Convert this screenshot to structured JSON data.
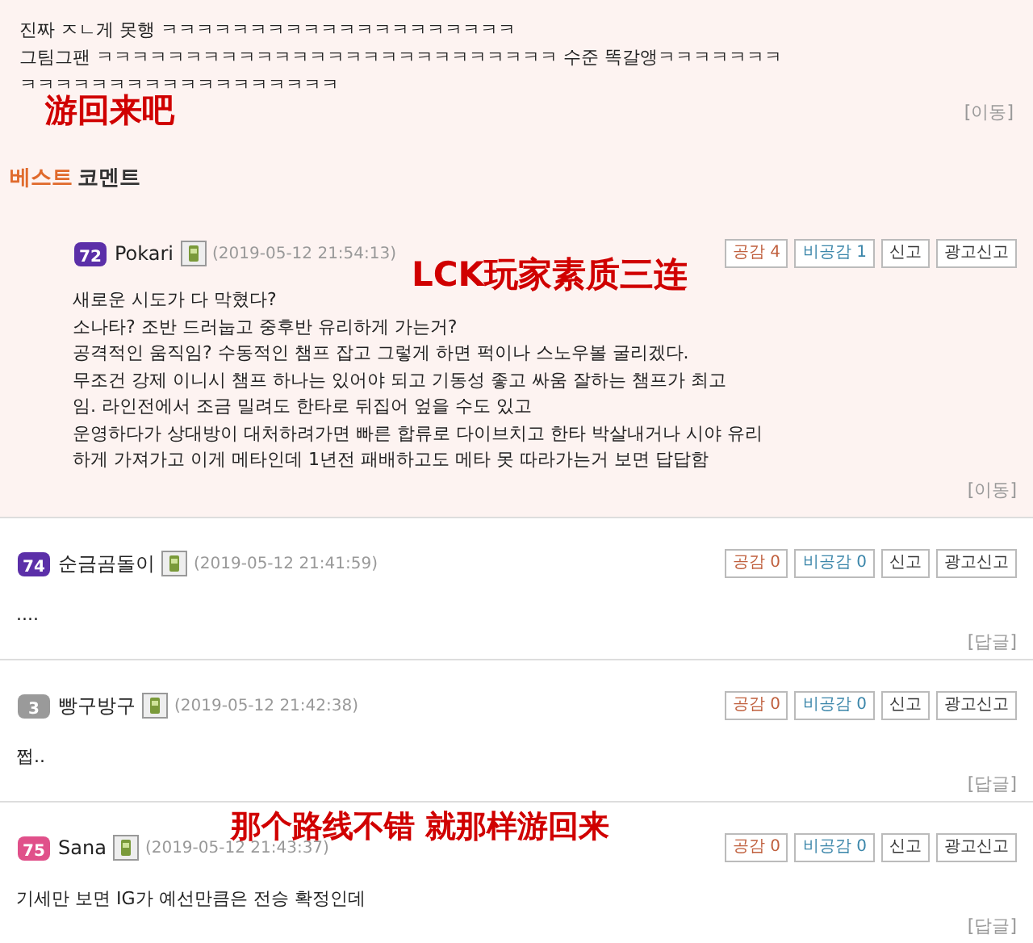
{
  "previous_comment": {
    "lines": [
      "진짜 ㅈㄴ게 못행 ㅋㅋㅋㅋㅋㅋㅋㅋㅋㅋㅋㅋㅋㅋㅋㅋㅋㅋㅋㅋ",
      "그팀그팬 ㅋㅋㅋㅋㅋㅋㅋㅋㅋㅋㅋㅋㅋㅋㅋㅋㅋㅋㅋㅋㅋㅋㅋㅋㅋㅋ 수준 똑갈앵ㅋㅋㅋㅋㅋㅋㅋ",
      "ㅋㅋㅋㅋㅋㅋㅋㅋㅋㅋㅋㅋㅋㅋㅋㅋㅋㅋ"
    ],
    "action": "[이동]"
  },
  "best_header": {
    "part_1": "베스트",
    "part_2": "코멘트"
  },
  "comments": [
    {
      "best": true,
      "level": "72",
      "color": "#5b2fa8",
      "user": "Pokari",
      "time": "(2019-05-12 21:54:13)",
      "likes": "공감 4",
      "dislikes": "비공감 1",
      "report": "신고",
      "ad_report": "광고신고",
      "lines": [
        "새로운 시도가 다 막혔다?",
        "소나타? 조반 드러눕고 중후반 유리하게 가는거?",
        "공격적인 움직임? 수동적인 챔프 잡고 그렇게 하면 퍽이나 스노우볼 굴리겠다.",
        "무조건 강제 이니시 챔프 하나는 있어야 되고 기동성 좋고 싸움 잘하는 챔프가 최고",
        "임. 라인전에서 조금 밀려도 한타로 뒤집어 엎을 수도 있고",
        "운영하다가 상대방이 대처하려가면 빠른 합류로 다이브치고 한타 박살내거나 시야 유리",
        "하게 가져가고 이게 메타인데 1년전 패배하고도 메타 못 따라가는거 보면 답답함"
      ],
      "action": "[이동]"
    },
    {
      "best": false,
      "level": "74",
      "color": "#5b2fa8",
      "user": "순금곰돌이",
      "time": "(2019-05-12 21:41:59)",
      "likes": "공감 0",
      "dislikes": "비공감 0",
      "report": "신고",
      "ad_report": "광고신고",
      "lines": [
        "...."
      ],
      "action": "[답글]"
    },
    {
      "best": false,
      "level": "3",
      "color": "#9a9a9a",
      "user": "빵구방구",
      "time": "(2019-05-12 21:42:38)",
      "likes": "공감 0",
      "dislikes": "비공감 0",
      "report": "신고",
      "ad_report": "광고신고",
      "lines": [
        "쩝.."
      ],
      "action": "[답글]"
    },
    {
      "best": false,
      "level": "75",
      "color": "#e0508a",
      "user": "Sana",
      "time": "(2019-05-12 21:43:37)",
      "likes": "공감 0",
      "dislikes": "비공감 0",
      "report": "신고",
      "ad_report": "광고신고",
      "lines": [
        "기세만 보면 IG가 예선만큼은 전승 확정인데"
      ],
      "action": "[답글]"
    }
  ],
  "annotations": [
    {
      "text": "游回来吧"
    },
    {
      "text": "LCK玩家素质三连"
    },
    {
      "text": "那个路线不错 就那样游回来"
    }
  ]
}
